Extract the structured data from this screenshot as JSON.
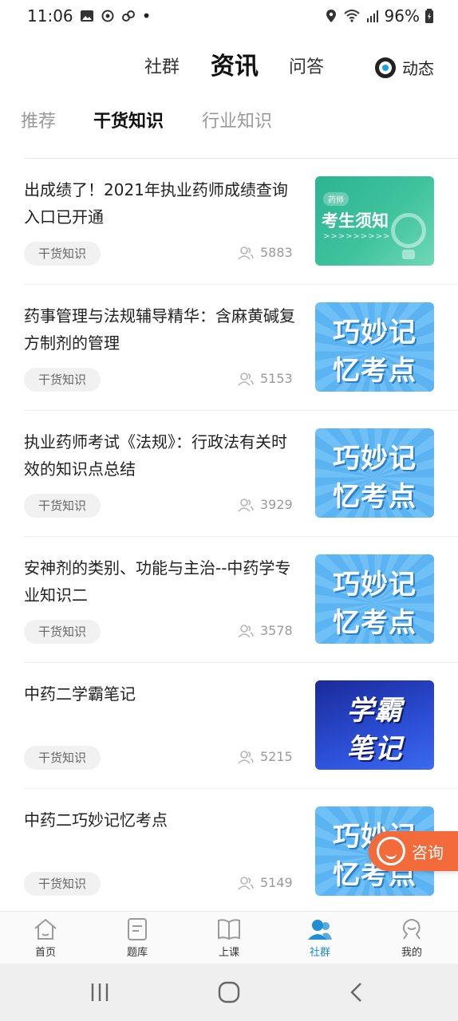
{
  "status_bar": {
    "time": "11:06",
    "dot": "•",
    "battery": "96%"
  },
  "top_tabs": [
    {
      "label": "社群",
      "active": false
    },
    {
      "label": "资讯",
      "active": true
    },
    {
      "label": "问答",
      "active": false
    }
  ],
  "dynamic_label": "动态",
  "sub_tabs": [
    {
      "label": "推荐",
      "active": false
    },
    {
      "label": "干货知识",
      "active": true
    },
    {
      "label": "行业知识",
      "active": false
    }
  ],
  "articles": [
    {
      "title": "出成绩了！2021年执业药师成绩查询入口已开通",
      "tag": "干货知识",
      "views": "5883",
      "thumb": {
        "style": "green",
        "badge": "药师",
        "title": "考生须知",
        "arrows": ">>>>>>>>>"
      }
    },
    {
      "title": "药事管理与法规辅导精华：含麻黄碱复方制剂的管理",
      "tag": "干货知识",
      "views": "5153",
      "thumb": {
        "style": "blue",
        "line1": "巧妙记",
        "line2": "忆考点"
      }
    },
    {
      "title": "执业药师考试《法规》：行政法有关时效的知识点总结",
      "tag": "干货知识",
      "views": "3929",
      "thumb": {
        "style": "blue",
        "line1": "巧妙记",
        "line2": "忆考点"
      }
    },
    {
      "title": "安神剂的类别、功能与主治--中药学专业知识二",
      "tag": "干货知识",
      "views": "3578",
      "thumb": {
        "style": "blue",
        "line1": "巧妙记",
        "line2": "忆考点"
      }
    },
    {
      "title": "中药二学霸笔记",
      "tag": "干货知识",
      "views": "5215",
      "thumb": {
        "style": "dark",
        "line1": "学霸",
        "line2": "笔记"
      }
    },
    {
      "title": "中药二巧妙记忆考点",
      "tag": "干货知识",
      "views": "5149",
      "thumb": {
        "style": "blue",
        "line1": "巧妙记",
        "line2": "忆考点"
      }
    }
  ],
  "consult_label": "咨询",
  "bottom_nav": [
    {
      "label": "首页",
      "icon": "home-icon",
      "active": false
    },
    {
      "label": "题库",
      "icon": "question-bank-icon",
      "active": false
    },
    {
      "label": "上课",
      "icon": "book-icon",
      "active": false
    },
    {
      "label": "社群",
      "icon": "community-icon",
      "active": true
    },
    {
      "label": "我的",
      "icon": "profile-icon",
      "active": false
    }
  ],
  "colors": {
    "accent": "#1e8fd4",
    "consult": "#f36a3b"
  }
}
